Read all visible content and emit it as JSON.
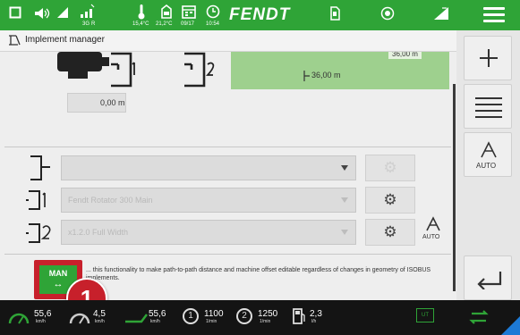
{
  "topbar": {
    "signal_label": "3G",
    "signal_sub": "R",
    "temp_outside": "15,4°C",
    "temp_inside": "21,2°C",
    "date": "09/17",
    "time": "10:54",
    "brand": "FENDT"
  },
  "window": {
    "title": "Implement manager"
  },
  "implement": {
    "width_top": "36,00 m",
    "working_width": "36,00 m",
    "offset_value": "0,00 m"
  },
  "rows": [
    {
      "value": "",
      "enabled": false
    },
    {
      "value": "Fendt Rotator 300 Main",
      "enabled": false
    },
    {
      "value": "x1.2.0 Full Width",
      "enabled": false
    }
  ],
  "auto_label": "AUTO",
  "man_button": {
    "label": "MAN",
    "description": "... this functionality to make path-to-path distance and machine offset editable regardless of changes in geometry of ISOBUS implements."
  },
  "callout": "1",
  "sidebar": {
    "auto_label": "AUTO"
  },
  "bottombar": {
    "speed1_value": "55,6",
    "speed1_unit": "km/h",
    "speed2_value": "4,5",
    "speed2_unit": "km/h",
    "speed3_value": "55,6",
    "speed3_unit": "km/h",
    "pto1_label": "1",
    "pto1_value": "1100",
    "pto1_unit": "1/min",
    "pto2_label": "2",
    "pto2_value": "1250",
    "pto2_unit": "1/min",
    "fuel_value": "2,3",
    "fuel_unit": "l/h",
    "ut_label": "UT"
  },
  "colors": {
    "fendt_green": "#2fa437",
    "implement_green": "#9ed08e",
    "highlight_red": "#c7202b",
    "bottom_bar": "#141414"
  }
}
